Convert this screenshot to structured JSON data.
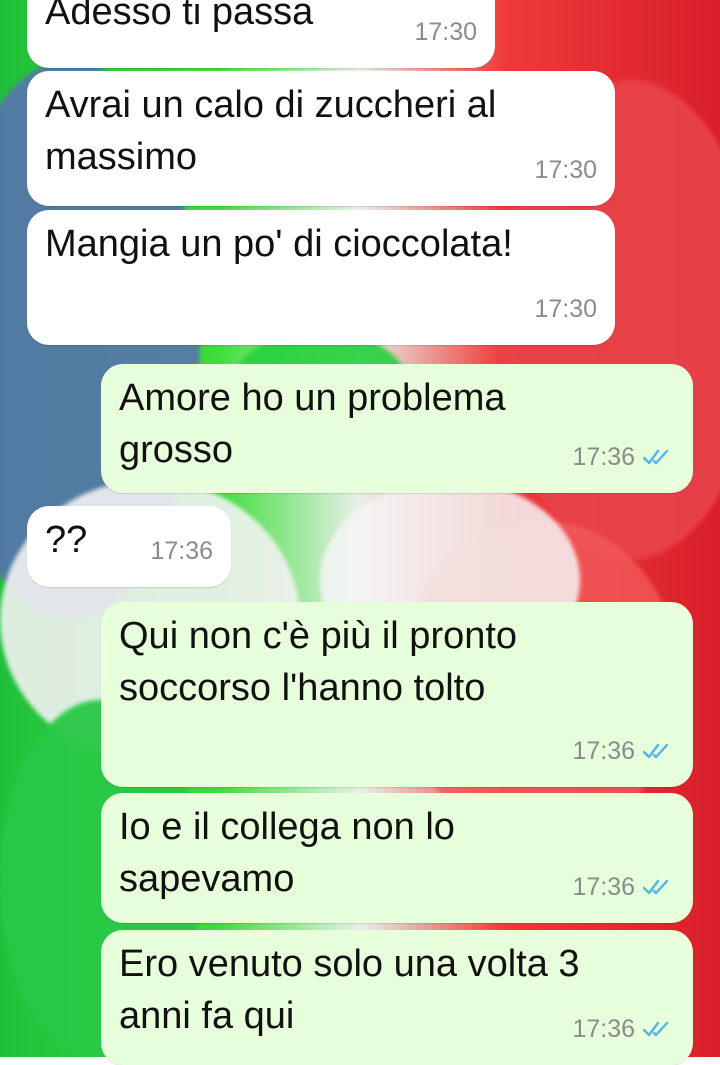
{
  "colors": {
    "incoming_bubble": "#ffffff",
    "outgoing_bubble": "#e7ffdb",
    "read_tick": "#4fb6ec",
    "time_text": "#8b8b8b"
  },
  "messages": [
    {
      "direction": "incoming",
      "text": "Adesso ti passa",
      "time": "17:30"
    },
    {
      "direction": "incoming",
      "text": "Avrai un calo di zuccheri al massimo",
      "time": "17:30"
    },
    {
      "direction": "incoming",
      "text": "Mangia un po' di cioccolata!",
      "time": "17:30"
    },
    {
      "direction": "outgoing",
      "text": "Amore ho un problema grosso",
      "time": "17:36",
      "status": "read"
    },
    {
      "direction": "incoming",
      "text": "??",
      "time": "17:36"
    },
    {
      "direction": "outgoing",
      "text": "Qui non c'è più il pronto soccorso l'hanno tolto",
      "time": "17:36",
      "status": "read"
    },
    {
      "direction": "outgoing",
      "text": "Io e il collega non lo sapevamo",
      "time": "17:36",
      "status": "read"
    },
    {
      "direction": "outgoing",
      "text": "Ero venuto solo una volta 3 anni fa qui",
      "time": "17:36",
      "status": "read"
    }
  ]
}
